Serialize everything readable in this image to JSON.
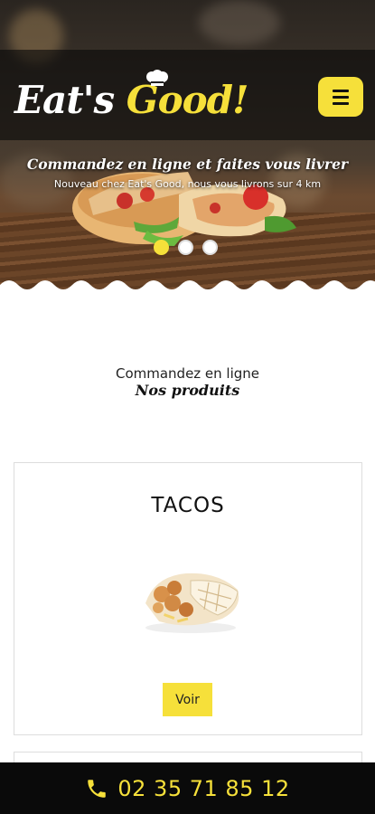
{
  "brand": {
    "logo_main": "Eat's ",
    "logo_accent": "Good!",
    "accent_color": "#f6e03a",
    "dark_color": "#0a0a0a"
  },
  "header": {
    "menu_icon": "hamburger-menu-icon"
  },
  "hero": {
    "title": "Commandez en ligne et faites vous livrer",
    "subtitle": "Nouveau chez Eat's Good, nous vous livrons sur 4 km",
    "slides_count": 3,
    "active_slide": 1
  },
  "section": {
    "kicker": "Commandez en ligne",
    "title": "Nos produits"
  },
  "products": [
    {
      "name": "TACOS",
      "button_label": "Voir",
      "image_icon": "tacos-image"
    }
  ],
  "footer": {
    "phone_icon": "phone-icon",
    "phone_number": "02 35 71 85 12"
  }
}
